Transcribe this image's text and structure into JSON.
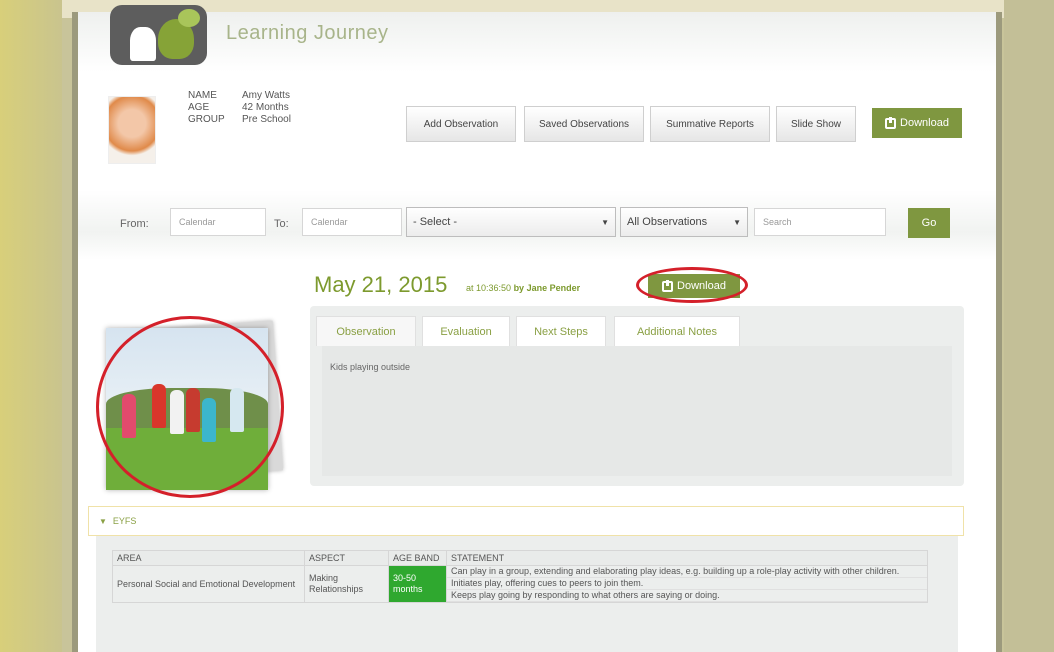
{
  "app": {
    "title": "Learning Journey"
  },
  "child": {
    "labels": [
      "NAME",
      "AGE",
      "GROUP"
    ],
    "values": [
      "Amy Watts",
      "42 Months",
      "Pre School"
    ]
  },
  "toolbar": {
    "add_observation": "Add Observation",
    "saved_observations": "Saved Observations",
    "summative_reports": "Summative Reports",
    "slide_show": "Slide Show",
    "download": "Download"
  },
  "filters": {
    "from_label": "From:",
    "to_label": "To:",
    "from_placeholder": "Calendar",
    "to_placeholder": "Calendar",
    "select_value": "- Select -",
    "observations_value": "All Observations",
    "search_placeholder": "Search",
    "go": "Go"
  },
  "observation": {
    "date": "May 21, 2015",
    "time": "at 10:36:50",
    "by": "by Jane Pender",
    "download": "Download",
    "tabs": [
      "Observation",
      "Evaluation",
      "Next Steps",
      "Additional Notes"
    ],
    "text": "Kids playing outside"
  },
  "eyfs": {
    "header": "EYFS",
    "columns": [
      "AREA",
      "ASPECT",
      "AGE BAND",
      "STATEMENT"
    ],
    "row": {
      "area": "Personal Social and Emotional Development",
      "aspect": "Making Relationships",
      "age_band": "30-50 months",
      "statements": [
        "Can play in a group, extending and elaborating play ideas, e.g. building up a role-play activity with other children.",
        "Initiates play, offering cues to peers to join them.",
        "Keeps play going by responding to what others are saying or doing."
      ]
    }
  },
  "colors": {
    "accent": "#7f9740",
    "highlight": "#d4202a",
    "age_band": "#2fa82f"
  }
}
